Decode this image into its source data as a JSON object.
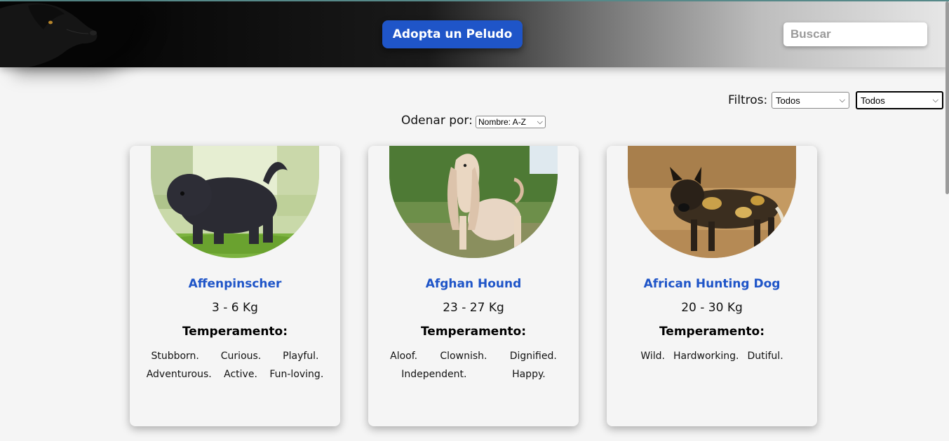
{
  "header": {
    "adopt_button": "Adopta un Peludo",
    "search_placeholder": "Buscar"
  },
  "filters": {
    "label": "Filtros:",
    "select1_value": "Todos",
    "select2_value": "Todos"
  },
  "sort": {
    "label": "Odenar por:",
    "value": "Nombre: A-Z"
  },
  "cards": [
    {
      "name": "Affenpinscher",
      "weight": "3 - 6 Kg",
      "temp_title": "Temperamento:",
      "temperaments": [
        "Stubborn.",
        "Curious.",
        "Playful.",
        "Adventurous.",
        "Active.",
        "Fun-loving."
      ]
    },
    {
      "name": "Afghan Hound",
      "weight": "23 - 27 Kg",
      "temp_title": "Temperamento:",
      "temperaments": [
        "Aloof.",
        "Clownish.",
        "Dignified.",
        "Independent.",
        "Happy."
      ]
    },
    {
      "name": "African Hunting Dog",
      "weight": "20 - 30 Kg",
      "temp_title": "Temperamento:",
      "temperaments": [
        "Wild.",
        "Hardworking.",
        "Dutiful."
      ]
    }
  ],
  "colors": {
    "accent": "#1f55c8",
    "background": "#f5f5f5"
  }
}
